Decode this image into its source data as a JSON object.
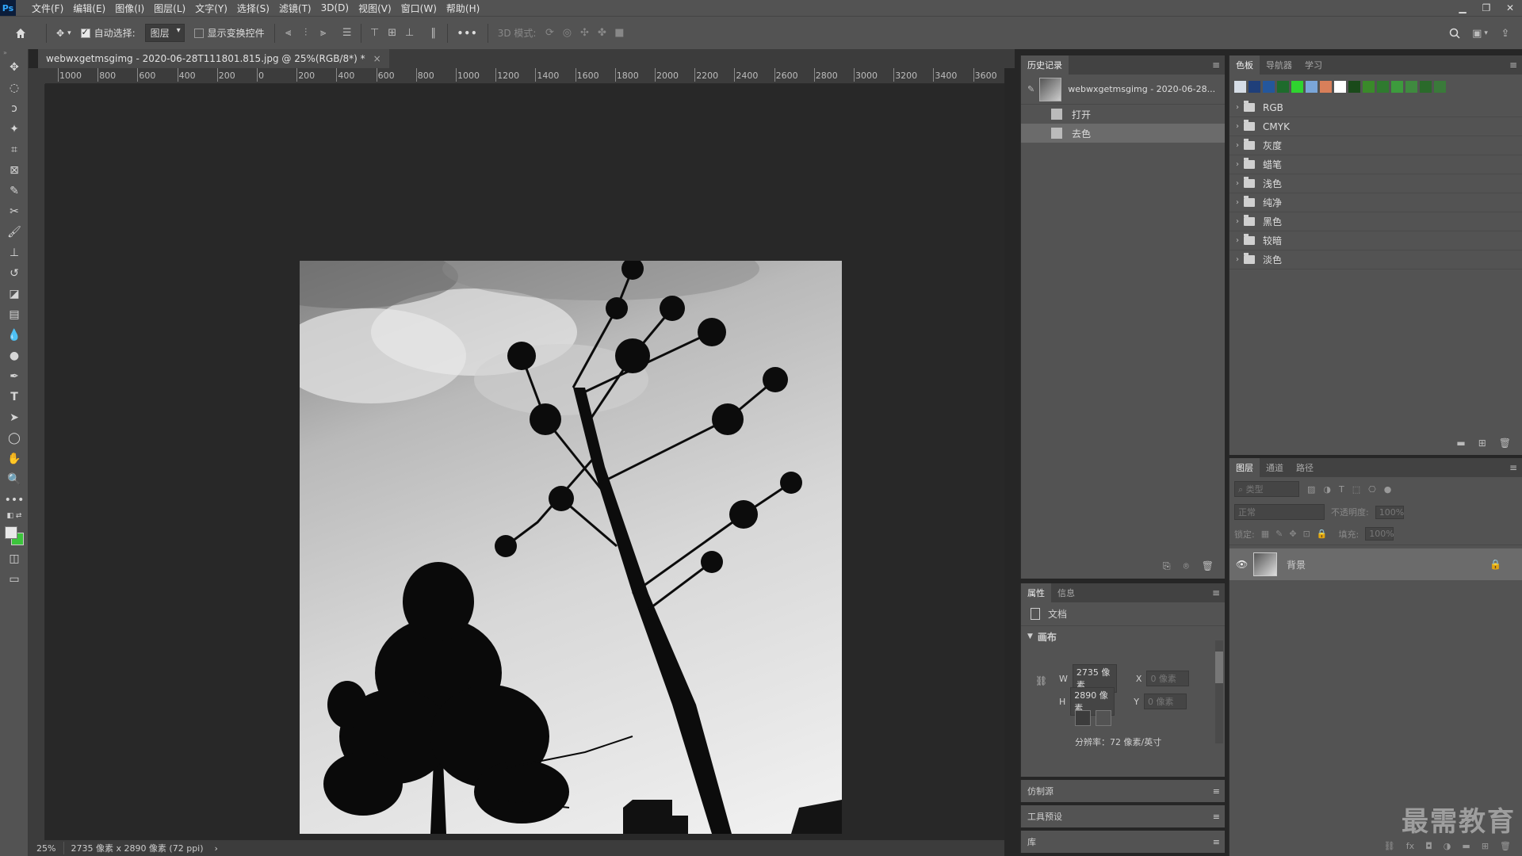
{
  "app": {
    "logo": "Ps"
  },
  "menu": [
    "文件(F)",
    "编辑(E)",
    "图像(I)",
    "图层(L)",
    "文字(Y)",
    "选择(S)",
    "滤镜(T)",
    "3D(D)",
    "视图(V)",
    "窗口(W)",
    "帮助(H)"
  ],
  "options": {
    "auto_select_label": "自动选择:",
    "auto_select_value": "图层",
    "show_transform_label": "显示变换控件",
    "more": "•••",
    "mode_3d_label": "3D 模式:"
  },
  "document": {
    "tab_title": "webwxgetmsgimg - 2020-06-28T111801.815.jpg @ 25%(RGB/8*) *",
    "close": "×",
    "zoom": "25%",
    "size_info": "2735 像素 x 2890 像素 (72 ppi)",
    "status_arrow": "›"
  },
  "ruler": [
    "1000",
    "800",
    "600",
    "400",
    "200",
    "0",
    "200",
    "400",
    "600",
    "800",
    "1000",
    "1200",
    "1400",
    "1600",
    "1800",
    "2000",
    "2200",
    "2400",
    "2600",
    "2800",
    "3000",
    "3200",
    "3400",
    "3600"
  ],
  "history": {
    "tab": "历史记录",
    "snapshot": "webwxgetmsgimg - 2020-06-28...",
    "items": [
      "打开",
      "去色"
    ]
  },
  "swatches": {
    "tabs": [
      "色板",
      "导航器",
      "学习"
    ],
    "colors": [
      "#d6dde6",
      "#1f3f7a",
      "#24579c",
      "#1e6b2c",
      "#2fd42f",
      "#7aa6d8",
      "#d87f5a",
      "#ffffff",
      "#1a4a1a",
      "#3a8a2a",
      "#2f7a2f",
      "#3d9b3d",
      "#3f8a3f",
      "#2a6a2a",
      "#3a7a3a"
    ],
    "groups": [
      "RGB",
      "CMYK",
      "灰度",
      "蜡笔",
      "浅色",
      "纯净",
      "黑色",
      "较暗",
      "淡色"
    ]
  },
  "properties": {
    "tabs": [
      "属性",
      "信息"
    ],
    "doc_label": "文档",
    "canvas_label": "画布",
    "w_label": "W",
    "w_value": "2735 像素",
    "h_label": "H",
    "h_value": "2890 像素",
    "x_label": "X",
    "x_value": "0 像素",
    "y_label": "Y",
    "y_value": "0 像素",
    "resolution": "分辨率：72 像素/英寸"
  },
  "collapsed_panels": [
    "仿制源",
    "工具预设",
    "库"
  ],
  "layers": {
    "tabs": [
      "图层",
      "通道",
      "路径"
    ],
    "search_placeholder": "类型",
    "blend_mode": "正常",
    "opacity_label": "不透明度:",
    "opacity_value": "100%",
    "lock_label": "锁定:",
    "fill_label": "填充:",
    "fill_value": "100%",
    "items": [
      {
        "name": "背景"
      }
    ]
  },
  "watermark": "最需教育",
  "colors": {
    "bg": "#535353",
    "dark": "#262626",
    "accent": "#31a8ff",
    "fg_swatch": "#e8e8e8",
    "bg_swatch": "#3cc43c"
  }
}
